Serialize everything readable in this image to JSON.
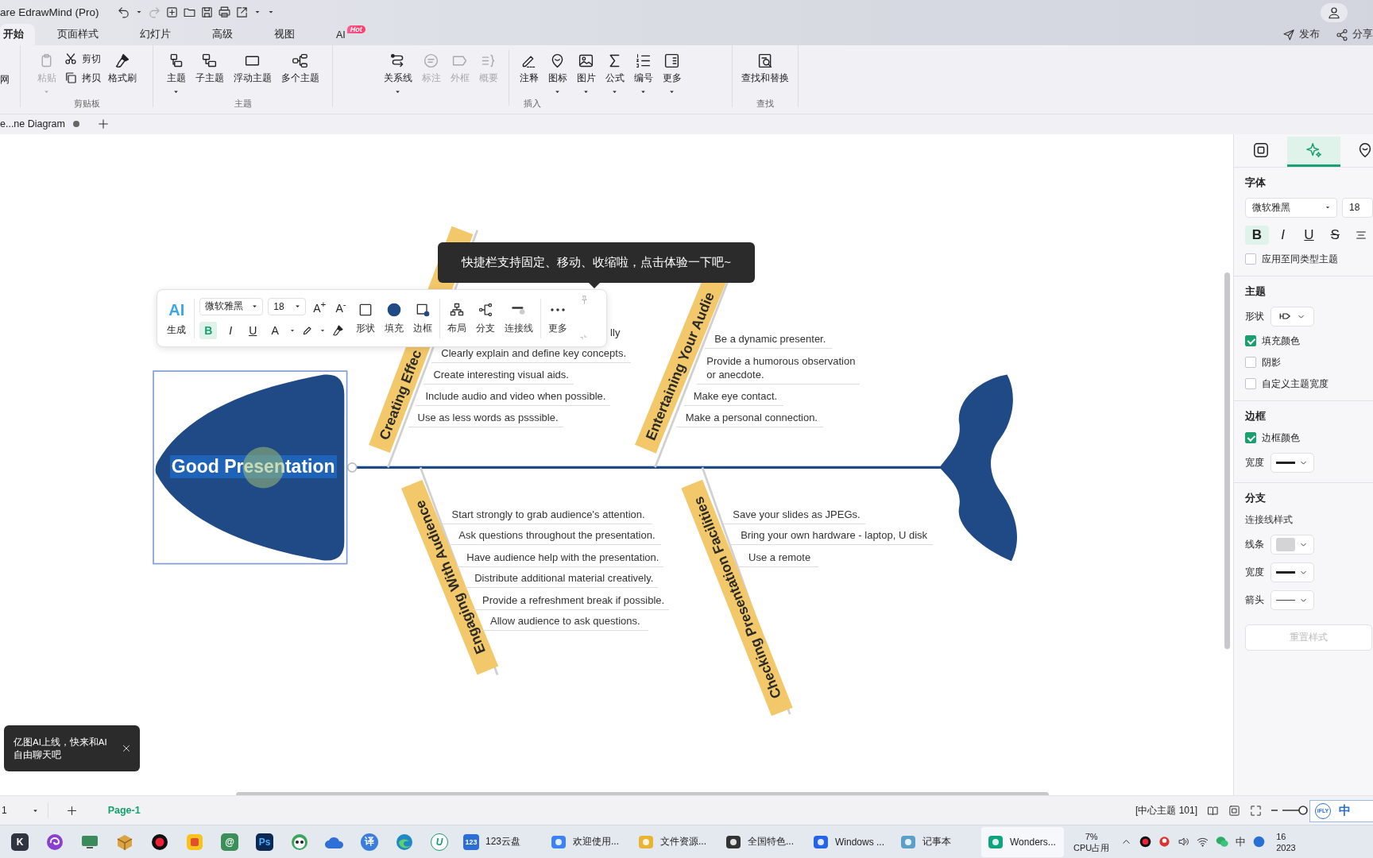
{
  "title_bar": {
    "app_title": "are EdrawMind (Pro)"
  },
  "menu_tabs": [
    {
      "label": "开始",
      "selected": true
    },
    {
      "label": "页面样式",
      "selected": false
    },
    {
      "label": "幻灯片",
      "selected": false
    },
    {
      "label": "高级",
      "selected": false
    },
    {
      "label": "视图",
      "selected": false
    },
    {
      "label": "AI",
      "selected": false,
      "badge": "Hot"
    }
  ],
  "header_actions": [
    {
      "label": "发布"
    },
    {
      "label": "分享"
    }
  ],
  "ribbon": {
    "leading_label": "网",
    "groups": [
      {
        "label": "剪贴板",
        "items": [
          {
            "kind": "large",
            "label": "粘贴",
            "disabled": true,
            "caret": true
          },
          {
            "kind": "stack",
            "items": [
              {
                "label": "剪切",
                "disabled": false
              },
              {
                "label": "拷贝",
                "disabled": false
              }
            ]
          },
          {
            "kind": "large",
            "label": "格式刷",
            "disabled": false,
            "caret": false
          }
        ]
      },
      {
        "label": "主题",
        "items": [
          {
            "kind": "large",
            "label": "主题",
            "disabled": false,
            "caret": true
          },
          {
            "kind": "large",
            "label": "子主题",
            "disabled": false,
            "caret": false
          },
          {
            "kind": "large",
            "label": "浮动主题",
            "disabled": false,
            "caret": false
          },
          {
            "kind": "large",
            "label": "多个主题",
            "disabled": false,
            "caret": false
          }
        ]
      },
      {
        "label": "插入",
        "items": [
          {
            "kind": "large",
            "label": "关系线",
            "disabled": false,
            "caret": true
          },
          {
            "kind": "large",
            "label": "标注",
            "disabled": true,
            "caret": false
          },
          {
            "kind": "large",
            "label": "外框",
            "disabled": true,
            "caret": false
          },
          {
            "kind": "large",
            "label": "概要",
            "disabled": true,
            "caret": false
          },
          {
            "kind": "large",
            "label": "注释",
            "disabled": false,
            "caret": false
          },
          {
            "kind": "large",
            "label": "图标",
            "disabled": false,
            "caret": true
          },
          {
            "kind": "large",
            "label": "图片",
            "disabled": false,
            "caret": true
          },
          {
            "kind": "large",
            "label": "公式",
            "disabled": false,
            "caret": true
          },
          {
            "kind": "large",
            "label": "编号",
            "disabled": false,
            "caret": true
          },
          {
            "kind": "large",
            "label": "更多",
            "disabled": false,
            "caret": true
          }
        ]
      },
      {
        "label": "查找",
        "items": [
          {
            "kind": "large",
            "label": "查找和替换",
            "disabled": false,
            "caret": false
          }
        ]
      }
    ]
  },
  "document_tabs": [
    {
      "label": "e...ne Diagram",
      "unsaved": true
    }
  ],
  "diagram": {
    "main_topic": {
      "label": "Good Presentation",
      "selected": true
    },
    "bones": [
      {
        "label": "Creating Effec",
        "items": [
          {
            "label": "lly",
            "kind": "partly-hidden"
          },
          {
            "label": "Clearly explain and define key concepts."
          },
          {
            "label": "Create interesting visual aids."
          },
          {
            "label": "Include audio and video when possible."
          },
          {
            "label": "Use as less words as psssible."
          }
        ]
      },
      {
        "label": "Entertaining Your Audie",
        "items": [
          {
            "label": "Be a dynamic presenter."
          },
          {
            "label": "Provide a humorous observation\nor anecdote."
          },
          {
            "label": "Make eye contact."
          },
          {
            "label": "Make a personal connection."
          }
        ]
      },
      {
        "label": "Engaging With  Audience",
        "items": [
          {
            "label": "Start strongly to grab audience's attention."
          },
          {
            "label": "Ask questions throughout the presentation."
          },
          {
            "label": "Have audience help with the presentation."
          },
          {
            "label": "Distribute additional material creatively."
          },
          {
            "label": "Provide a refreshment break if possible."
          },
          {
            "label": "Allow audience to ask questions."
          }
        ]
      },
      {
        "label": "Checking Presentation Facilities",
        "items": [
          {
            "label": "Save your slides as JPEGs."
          },
          {
            "label": "Bring your own hardware - laptop, U disk"
          },
          {
            "label": "Use a remote"
          }
        ]
      }
    ]
  },
  "floating_toolbar": {
    "ai_label": "AI",
    "ai_caption": "生成",
    "font": "微软雅黑",
    "size": "18",
    "grow": "A$^{+}$",
    "shrink": "A$^{-}$",
    "styles": [
      {
        "label": "B",
        "selected": true
      },
      {
        "label": "I",
        "selected": false
      },
      {
        "label": "U",
        "selected": false
      }
    ],
    "font_color": "A",
    "tools": [
      {
        "label": "形状"
      },
      {
        "label": "填充"
      },
      {
        "label": "边框"
      },
      {
        "label": "布局"
      },
      {
        "label": "分支"
      },
      {
        "label": "连接线"
      },
      {
        "label": "更多"
      }
    ]
  },
  "tooltip": "快捷栏支持固定、移动、收缩啦，点击体验一下吧~",
  "notification": {
    "lines": [
      "亿图AI上线，快来和AI",
      "自由聊天吧"
    ]
  },
  "properties_panel": {
    "tabs": [
      {
        "selected": false
      },
      {
        "selected": true
      },
      {
        "selected": false
      }
    ],
    "font_title": "字体",
    "font": "微软雅黑",
    "size": "18",
    "styles": [
      {
        "label": "B",
        "selected": true
      },
      {
        "label": "I",
        "selected": false
      },
      {
        "label": "U",
        "selected": false
      },
      {
        "label": "S",
        "selected": false
      }
    ],
    "apply_same": {
      "label": "应用至同类型主题",
      "checked": false
    },
    "topic_title": "主题",
    "shape_label": "形状",
    "topic_options": [
      {
        "label": "填充颜色",
        "checked": true
      },
      {
        "label": "阴影",
        "checked": false
      },
      {
        "label": "自定义主题宽度",
        "checked": false
      }
    ],
    "border_title": "边框",
    "border_options": [
      {
        "label": "边框颜色",
        "checked": true
      }
    ],
    "border_width_label": "宽度",
    "branch_title": "分支",
    "branch_subtitle": "连接线样式",
    "branch_rows": [
      {
        "label": "线条",
        "kind": "color"
      },
      {
        "label": "宽度",
        "kind": "thick"
      },
      {
        "label": "箭头",
        "kind": "thin"
      }
    ],
    "reset_button": {
      "label": "重置样式",
      "disabled": true
    }
  },
  "status_bar": {
    "page_select": "1",
    "pages": [
      {
        "label": "Page-1",
        "selected": true
      }
    ],
    "info": "[中心主题 101]",
    "ime_badge": "iFLY",
    "ime": "中"
  },
  "taskbar": {
    "pinned": [
      {
        "kind": "letter",
        "glyph": "K"
      },
      {
        "kind": "swirl"
      },
      {
        "kind": "screen"
      },
      {
        "kind": "box"
      },
      {
        "kind": "record"
      },
      {
        "kind": "grid"
      },
      {
        "kind": "letter",
        "glyph": "@"
      },
      {
        "kind": "letter",
        "glyph": "Ps"
      },
      {
        "kind": "panda"
      },
      {
        "kind": "cloud"
      },
      {
        "kind": "letter",
        "glyph": "译"
      },
      {
        "kind": "browser"
      },
      {
        "kind": "letter",
        "glyph": "U"
      }
    ],
    "apps": [
      {
        "label": "123云盘",
        "glyph": "123",
        "active": false
      },
      {
        "label": "欢迎使用...",
        "active": false
      },
      {
        "label": "文件资源...",
        "active": false
      },
      {
        "label": "全国特色...",
        "active": false
      },
      {
        "label": "Windows ...",
        "active": false
      },
      {
        "label": "记事本",
        "active": false
      },
      {
        "label": "Wonders...",
        "active": true
      }
    ],
    "cpu": "7%",
    "cpu_label": "CPU占用",
    "ime": "中",
    "clock": [
      "16",
      "2023"
    ]
  }
}
